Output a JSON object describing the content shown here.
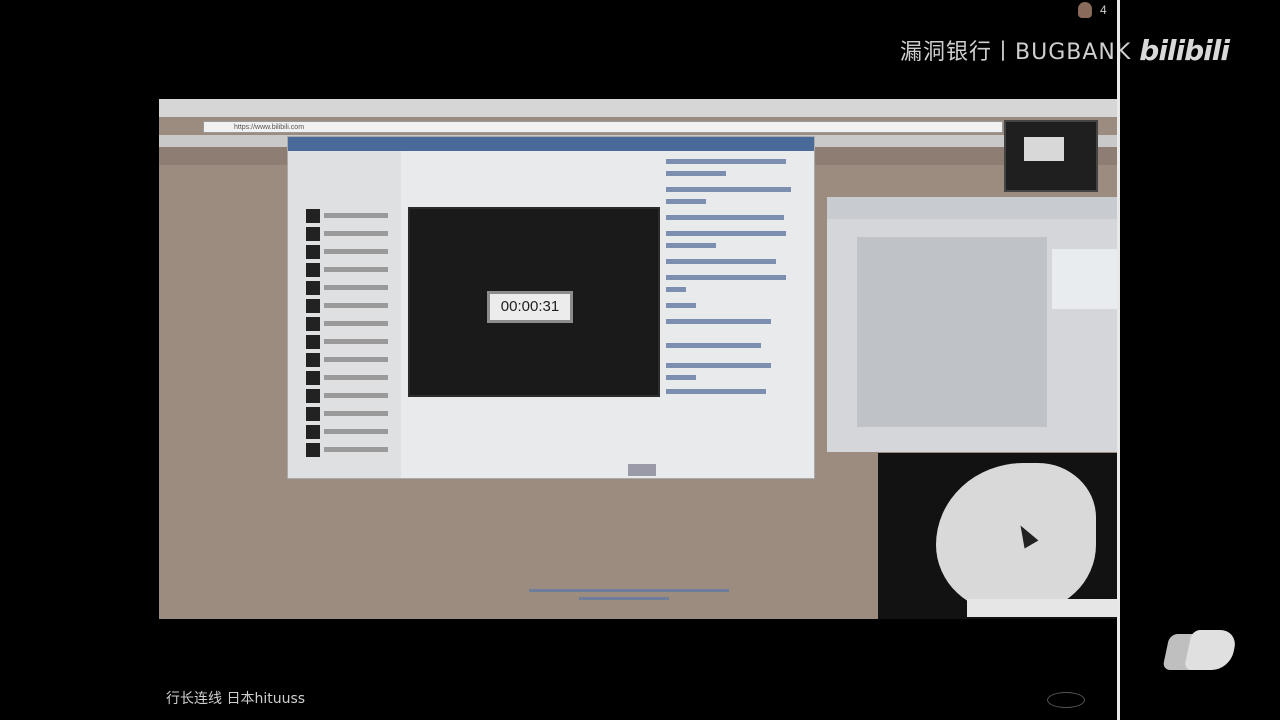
{
  "watermark": {
    "site_text": "漏洞银行丨BUGBANK",
    "logo_text": "bilibili",
    "viewer_count": "4"
  },
  "screen": {
    "address_url": "https://www.bilibili.com",
    "timer": "00:00:31"
  },
  "caption": {
    "text": "行长连线 日本hituuss"
  },
  "colors": {
    "background": "#000000",
    "screen_bg": "#9c8c80",
    "chat_title": "#4a6a9a"
  }
}
